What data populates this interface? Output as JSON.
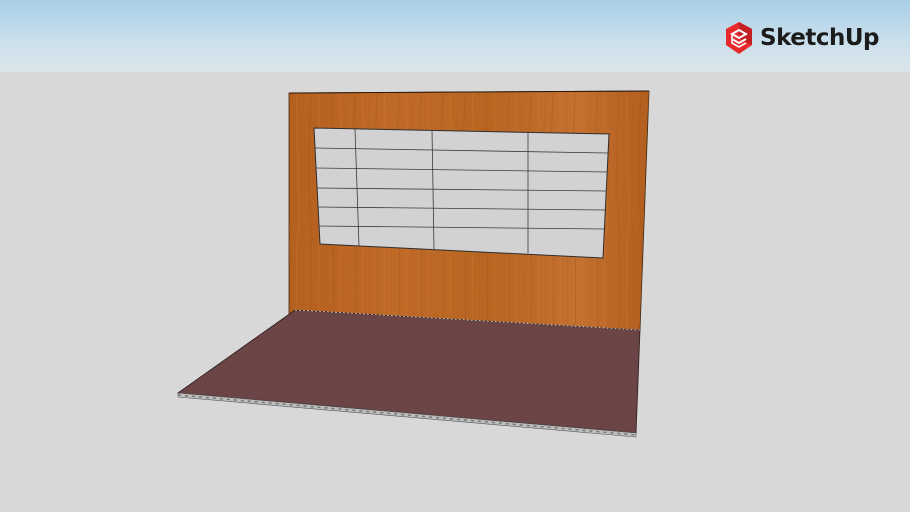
{
  "brand": {
    "name": "SketchUp",
    "logo_icon": "sketchup-logo-icon",
    "accent": "#e72b2d"
  },
  "scene": {
    "sky_color": "#a9cfe8",
    "ground_color": "#d8d8d8",
    "wall_color": "#b8621f",
    "floor_color": "#6b4446",
    "window_color": "#d2d2d4",
    "window_grid": {
      "rows": 6,
      "columns": 4
    }
  }
}
